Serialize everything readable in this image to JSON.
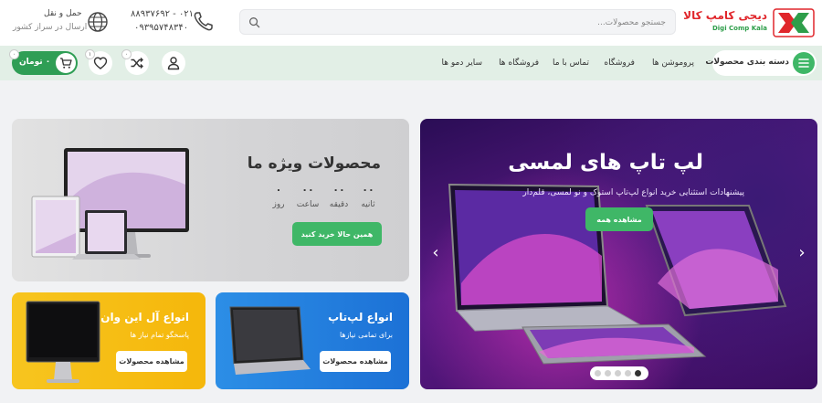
{
  "brand": {
    "name_fa": "دیجی کامپ کالا",
    "name_en": "Digi Comp Kala",
    "colors": {
      "red": "#e0262b",
      "green": "#3fb767"
    }
  },
  "header": {
    "search_placeholder": "جستجو محصولات...",
    "phone1": "۰۲۱ - ۸۸۹۳۷۶۹۲",
    "phone2": "۰۹۳۹۵۷۴۸۳۴۰",
    "shipping_title": "حمل و نقل",
    "shipping_sub": "ارسال در سراز کشور"
  },
  "nav": {
    "categories_label": "دسته بندی محصولات",
    "links": [
      "پروموشن ها",
      "فروشگاه",
      "تماس با ما",
      "فروشگاه ها",
      "سایر دمو ها"
    ],
    "compare_count": "۰",
    "wishlist_count": "۱",
    "cart_count": "۰",
    "cart_price": "۰ تومان"
  },
  "hero": {
    "title": "لپ تاپ های لمسی",
    "subtitle": "پیشنهادات استثنایی خرید انواع لپ‌تاپ استوک و نو لمسی، قلم‌دار",
    "button": "مشاهده همه",
    "slide_count": 5,
    "active_slide": 5
  },
  "special": {
    "title": "محصولات ویژه ما",
    "countdown": [
      {
        "value": "۰۰",
        "label": "ثانیه"
      },
      {
        "value": "۰۰",
        "label": "دقیقه"
      },
      {
        "value": "۰۰",
        "label": "ساعت"
      },
      {
        "value": "۰",
        "label": "روز"
      }
    ],
    "button": "همین حالا خرید کنید"
  },
  "banners": {
    "laptops": {
      "title": "انواع لپ‌تاپ",
      "subtitle": "برای تمامی نیازها",
      "button": "مشاهده محصولات"
    },
    "aio": {
      "title": "انواع آل این وان",
      "subtitle": "پاسخگو تمام نیاز ها",
      "button": "مشاهده محصولات"
    }
  }
}
